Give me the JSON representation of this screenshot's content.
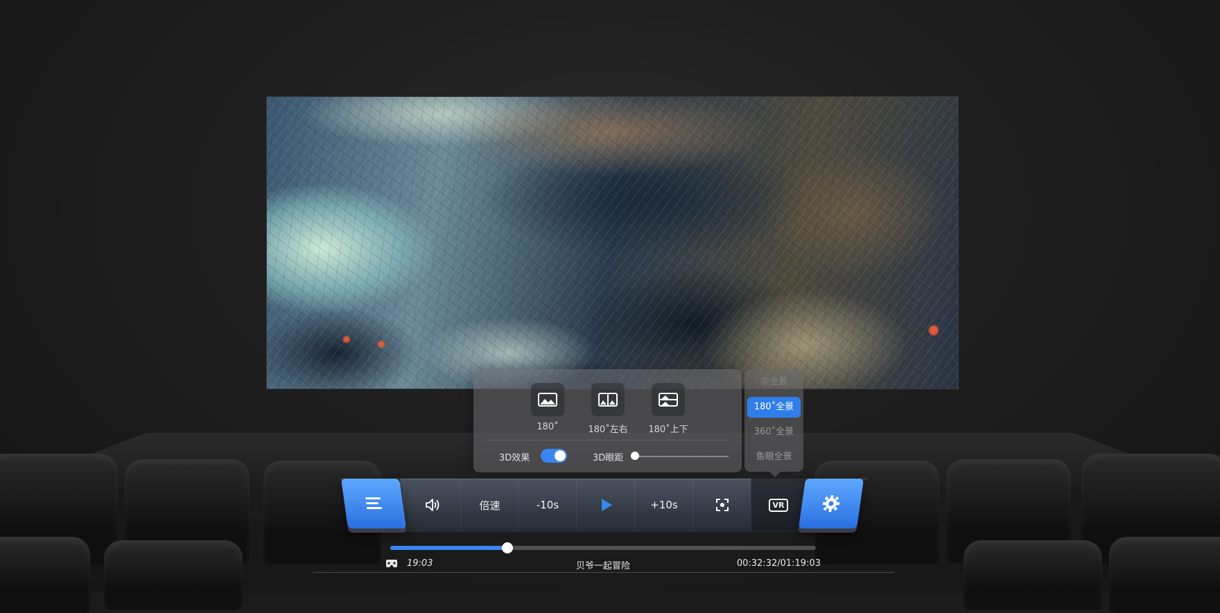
{
  "modes": [
    {
      "label": "180˚",
      "icon": "image-icon"
    },
    {
      "label": "180˚左右",
      "icon": "side-by-side-icon"
    },
    {
      "label": "180˚上下",
      "icon": "top-bottom-icon"
    }
  ],
  "effects": {
    "label_3d": "3D效果",
    "toggle_on": true,
    "label_eye": "3D眼距",
    "eye_distance": 0
  },
  "panorama": {
    "items": [
      "非全景",
      "180˚全景",
      "360˚全景",
      "鱼眼全景"
    ],
    "selected": "180˚全景"
  },
  "toolbar": {
    "menu_icon": "menu-icon",
    "volume_icon": "volume-icon",
    "speed_label": "倍速",
    "rewind_label": "-10s",
    "play_icon": "play-icon",
    "forward_label": "+10s",
    "fullscreen_icon": "fullscreen-icon",
    "vr_label": "VR",
    "settings_icon": "gear-icon"
  },
  "status": {
    "clock": "19:03",
    "title": "贝爷一起冒险",
    "timecode": "00:32:32/01:19:03",
    "progress": 0.2749
  },
  "colors": {
    "accent": "#3a86f0",
    "panel": "#69696e"
  }
}
